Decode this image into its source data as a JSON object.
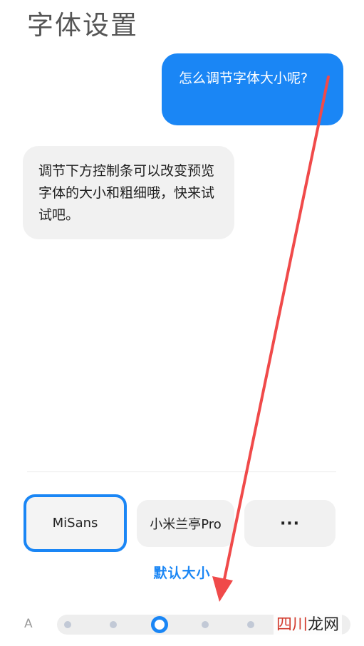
{
  "page": {
    "title": "字体设置"
  },
  "chat": {
    "user_message": "怎么调节字体大小呢?",
    "bot_message": "调节下方控制条可以改变预览字体的大小和粗细哦，快来试试吧。"
  },
  "fonts": {
    "options": [
      "MiSans",
      "小米兰亭Pro",
      "···"
    ],
    "selected": "MiSans"
  },
  "size": {
    "default_label": "默认大小",
    "min_label": "A",
    "steps": 5,
    "selected_index": 2
  },
  "watermark": {
    "prefix": "四川",
    "suffix": "龙网"
  },
  "colors": {
    "accent": "#1a86f5",
    "annotation": "#f04a4a"
  }
}
